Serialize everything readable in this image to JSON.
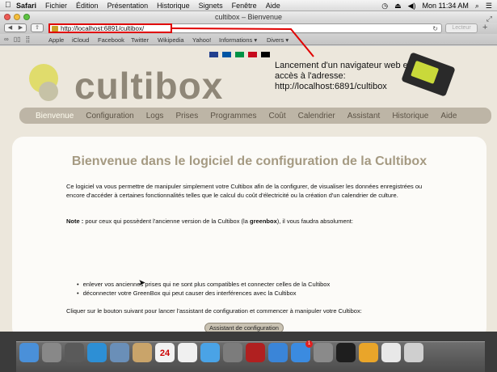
{
  "menubar": {
    "apple_icon": "apple-icon",
    "items": [
      "Safari",
      "Fichier",
      "Édition",
      "Présentation",
      "Historique",
      "Signets",
      "Fenêtre",
      "Aide"
    ],
    "clock": "Mon 11:34 AM"
  },
  "window": {
    "title": "cultibox – Bienvenue"
  },
  "toolbar": {
    "url": "http://localhost:6891/cultibox/",
    "reader_label": "Lecteur"
  },
  "bookmarks": [
    "Apple",
    "iCloud",
    "Facebook",
    "Twitter",
    "Wikipedia",
    "Yahoo!",
    "Informations ▾",
    "Divers ▾"
  ],
  "page": {
    "flags": [
      "#23408e",
      "#0055a4",
      "#009246",
      "#c60b1e",
      "#000000"
    ],
    "logo_text": "cultibox",
    "annotation": "Lancement d'un navigateur web et accès à l'adresse: http://localhost:6891/cultibox",
    "nav": [
      "Bienvenue",
      "Configuration",
      "Logs",
      "Prises",
      "Programmes",
      "Coût",
      "Calendrier",
      "Assistant",
      "Historique",
      "Aide"
    ],
    "heading": "Bienvenue dans le logiciel de configuration de la Cultibox",
    "intro": "Ce logiciel va vous permettre de manipuler simplement votre Cultibox afin de la configurer, de visualiser les données enregistrées ou encore d'accéder à certaines fonctionnalités telles que le calcul du coût d'électricité ou la création d'un calendrier de culture.",
    "note_label": "Note :",
    "note_text": " pour ceux qui possèdent l'ancienne version de la Cultibox (la ",
    "note_bold": "greenbox",
    "note_end": "), il vous faudra absolument:",
    "bullets": [
      "enlever vos anciennes prises qui ne sont plus compatibles et connecter celles de la Cultibox",
      "déconnecter votre GreenBox qui peut causer des interférences avec la Cultibox"
    ],
    "cta_text": "Cliquer sur le bouton suivant pour lancer l'assistant de configuration et commencer à manipuler votre Cultibox:",
    "button": "Assistant de configuration"
  },
  "dock": {
    "icons": [
      "finder-icon",
      "launchpad-icon",
      "mission-control-icon",
      "safari-icon",
      "mail-icon",
      "contacts-icon",
      "calendar-icon",
      "notes-icon",
      "messages-icon",
      "facetime-icon",
      "photo-booth-icon",
      "itunes-icon",
      "app-store-icon",
      "system-preferences-icon",
      "terminal-icon",
      "chrome-icon",
      "document-icon",
      "trash-icon"
    ],
    "calendar_day": "24",
    "app_store_badge": "1"
  }
}
